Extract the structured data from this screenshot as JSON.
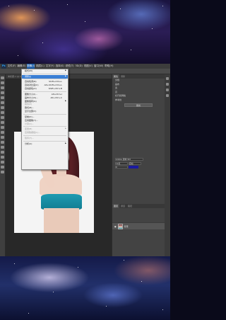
{
  "menubar": {
    "logo": "Ps",
    "items": [
      "文件(F)",
      "编辑(E)",
      "图像(I)",
      "图层(L)",
      "文字(Y)",
      "选择(S)",
      "滤镜(T)",
      "3D(D)",
      "视图(V)",
      "窗口(W)",
      "帮助(H)"
    ],
    "active_index": 2
  },
  "tabs": [
    {
      "label": "未标题-1 @ 100%"
    },
    {
      "label": "timg (1).jpg @ 66.7%"
    }
  ],
  "image_menu": {
    "items": [
      {
        "label": "模式(M)",
        "shortcut": "",
        "submenu": true,
        "disabled": false,
        "highlight": false
      },
      {
        "sep": true
      },
      {
        "label": "调整(J)",
        "shortcut": "",
        "submenu": true,
        "disabled": false,
        "highlight": true
      },
      {
        "sep": true
      },
      {
        "label": "自动色调(N)",
        "shortcut": "Shift+Ctrl+L",
        "submenu": false,
        "disabled": false,
        "highlight": false
      },
      {
        "label": "自动对比度(U)",
        "shortcut": "Alt+Shift+Ctrl+L",
        "submenu": false,
        "disabled": false,
        "highlight": false
      },
      {
        "label": "自动颜色(O)",
        "shortcut": "Shift+Ctrl+B",
        "submenu": false,
        "disabled": false,
        "highlight": false
      },
      {
        "sep": true
      },
      {
        "label": "图像大小(I)...",
        "shortcut": "Alt+Ctrl+I",
        "submenu": false,
        "disabled": false,
        "highlight": false
      },
      {
        "label": "画布大小(S)...",
        "shortcut": "Alt+Ctrl+C",
        "submenu": false,
        "disabled": false,
        "highlight": false
      },
      {
        "label": "图像旋转(G)",
        "shortcut": "",
        "submenu": true,
        "disabled": false,
        "highlight": false
      },
      {
        "label": "裁剪(P)",
        "shortcut": "",
        "submenu": false,
        "disabled": true,
        "highlight": false
      },
      {
        "label": "裁切(R)...",
        "shortcut": "",
        "submenu": false,
        "disabled": false,
        "highlight": false
      },
      {
        "label": "显示全部(V)",
        "shortcut": "",
        "submenu": false,
        "disabled": false,
        "highlight": false
      },
      {
        "sep": true
      },
      {
        "label": "复制(D)...",
        "shortcut": "",
        "submenu": false,
        "disabled": false,
        "highlight": false
      },
      {
        "label": "应用图像(Y)...",
        "shortcut": "",
        "submenu": false,
        "disabled": false,
        "highlight": false
      },
      {
        "label": "计算(C)...",
        "shortcut": "",
        "submenu": false,
        "disabled": true,
        "highlight": false
      },
      {
        "sep": true
      },
      {
        "label": "变量(B)",
        "shortcut": "",
        "submenu": true,
        "disabled": true,
        "highlight": false
      },
      {
        "label": "应用数据组(L)...",
        "shortcut": "",
        "submenu": false,
        "disabled": true,
        "highlight": false
      },
      {
        "sep": true
      },
      {
        "label": "陷印(T)...",
        "shortcut": "",
        "submenu": false,
        "disabled": true,
        "highlight": false
      },
      {
        "sep": true
      },
      {
        "label": "分析(A)",
        "shortcut": "",
        "submenu": true,
        "disabled": false,
        "highlight": false
      }
    ]
  },
  "properties": {
    "tabs": [
      "属性",
      "调整"
    ],
    "lines": [
      "文档",
      "画布",
      "宽",
      "高",
      "标尺和网格",
      "参考线"
    ],
    "button": "裁剪"
  },
  "character": {
    "font": "Adobe 黑体 Std",
    "size": "12点",
    "leading": "自动",
    "tracking": "0"
  },
  "layers": {
    "tabs": [
      "图层",
      "通道",
      "路径"
    ],
    "row_name": "背景"
  }
}
